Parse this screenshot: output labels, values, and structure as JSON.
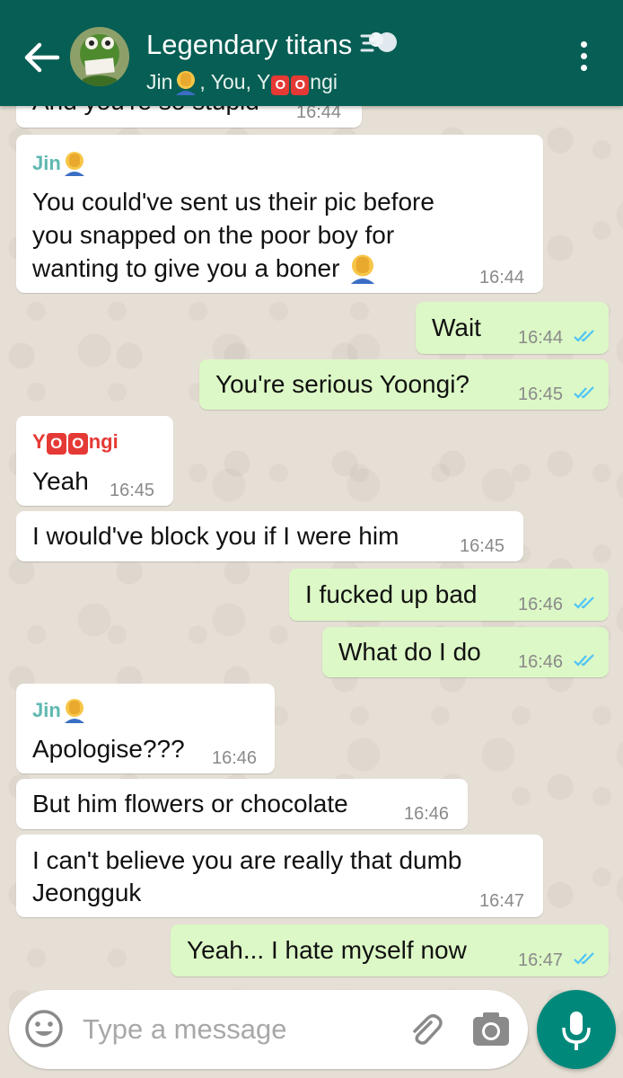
{
  "header": {
    "title": "Legendary titans",
    "subtitle_members": ", You, Y",
    "subtitle_end": "ngi",
    "subtitle_jin": "Jin",
    "oo_letter": "O"
  },
  "messages": [
    {
      "text": "And you're so stupid",
      "time": "16:44"
    },
    {
      "sender": "Jin",
      "lines": [
        "You could've sent us their pic before",
        "you snapped on the poor boy for",
        "wanting to give you a boner"
      ],
      "time": "16:44"
    },
    {
      "text": "Wait",
      "time": "16:44"
    },
    {
      "text": "You're serious Yoongi?",
      "time": "16:45"
    },
    {
      "sender_prefix": "Y",
      "sender_suffix": "ngi",
      "text": "Yeah",
      "time": "16:45"
    },
    {
      "text": "I would've block you if I were him",
      "time": "16:45"
    },
    {
      "text": "I fucked up bad",
      "time": "16:46"
    },
    {
      "text": "What do I do",
      "time": "16:46"
    },
    {
      "sender": "Jin",
      "text": "Apologise???",
      "time": "16:46"
    },
    {
      "text": "But him flowers or chocolate",
      "time": "16:46"
    },
    {
      "lines": [
        "I can't believe you are really that dumb",
        "Jeongguk"
      ],
      "time": "16:47"
    },
    {
      "text": "Yeah... I hate myself now",
      "time": "16:47"
    }
  ],
  "input": {
    "placeholder": "Type a message"
  },
  "colors": {
    "header": "#075e54",
    "incoming": "#ffffff",
    "outgoing": "#dcf8c6",
    "jin_name": "#5fb8b0",
    "yoongi_name": "#e53935",
    "read_ticks": "#4fc3f7",
    "mic": "#00897b"
  }
}
